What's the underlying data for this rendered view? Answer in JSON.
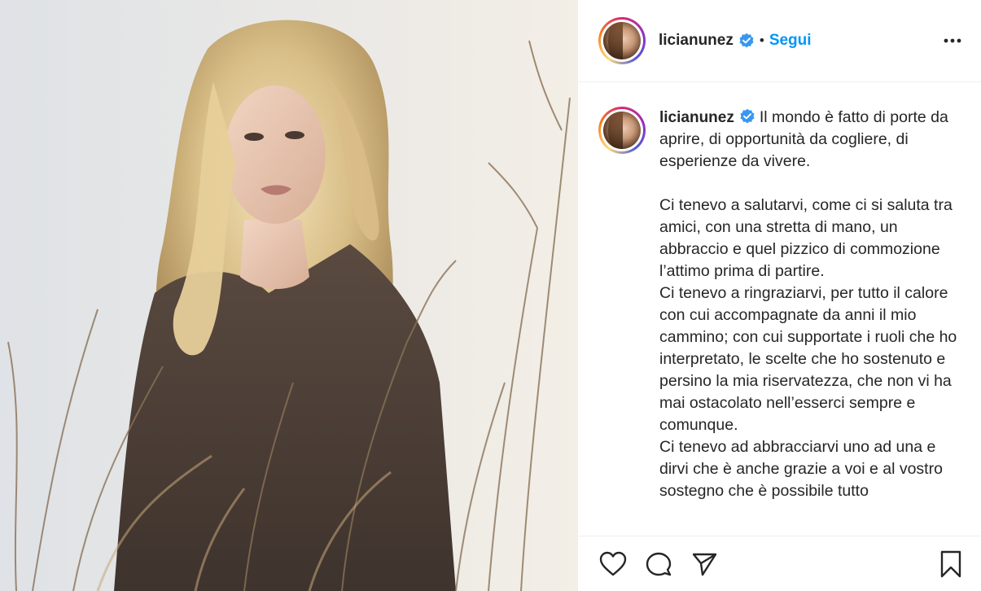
{
  "post": {
    "username": "licianunez",
    "separator": "•",
    "follow_label": "Segui",
    "caption_paragraphs": [
      "Il mondo è fatto di porte da aprire, di opportunità da cogliere, di esperienze da vivere.",
      "",
      "Ci tenevo a salutarvi, come ci si saluta tra amici, con una stretta di mano, un abbraccio e quel pizzico di commozione l’attimo prima di partire.",
      "Ci tenevo a ringraziarvi, per tutto il calore con cui accompagnate da anni il mio cammino; con cui supportate i ruoli che ho interpretato, le scelte che ho sostenuto e persino la mia riservatezza, che non vi ha mai ostacolato nell’esserci sempre e comunque.",
      "Ci tenevo ad abbracciarvi uno ad una e dirvi che è anche grazie a voi e al vostro sostegno che è possibile tutto"
    ]
  },
  "icons": {
    "verified": "verified-badge-icon",
    "more": "more-options-icon",
    "like": "heart-icon",
    "comment": "comment-icon",
    "share": "paper-plane-icon",
    "save": "bookmark-icon"
  },
  "colors": {
    "accent": "#0095f6",
    "text": "#262626",
    "border": "#efefef",
    "verified": "#3897f0"
  }
}
